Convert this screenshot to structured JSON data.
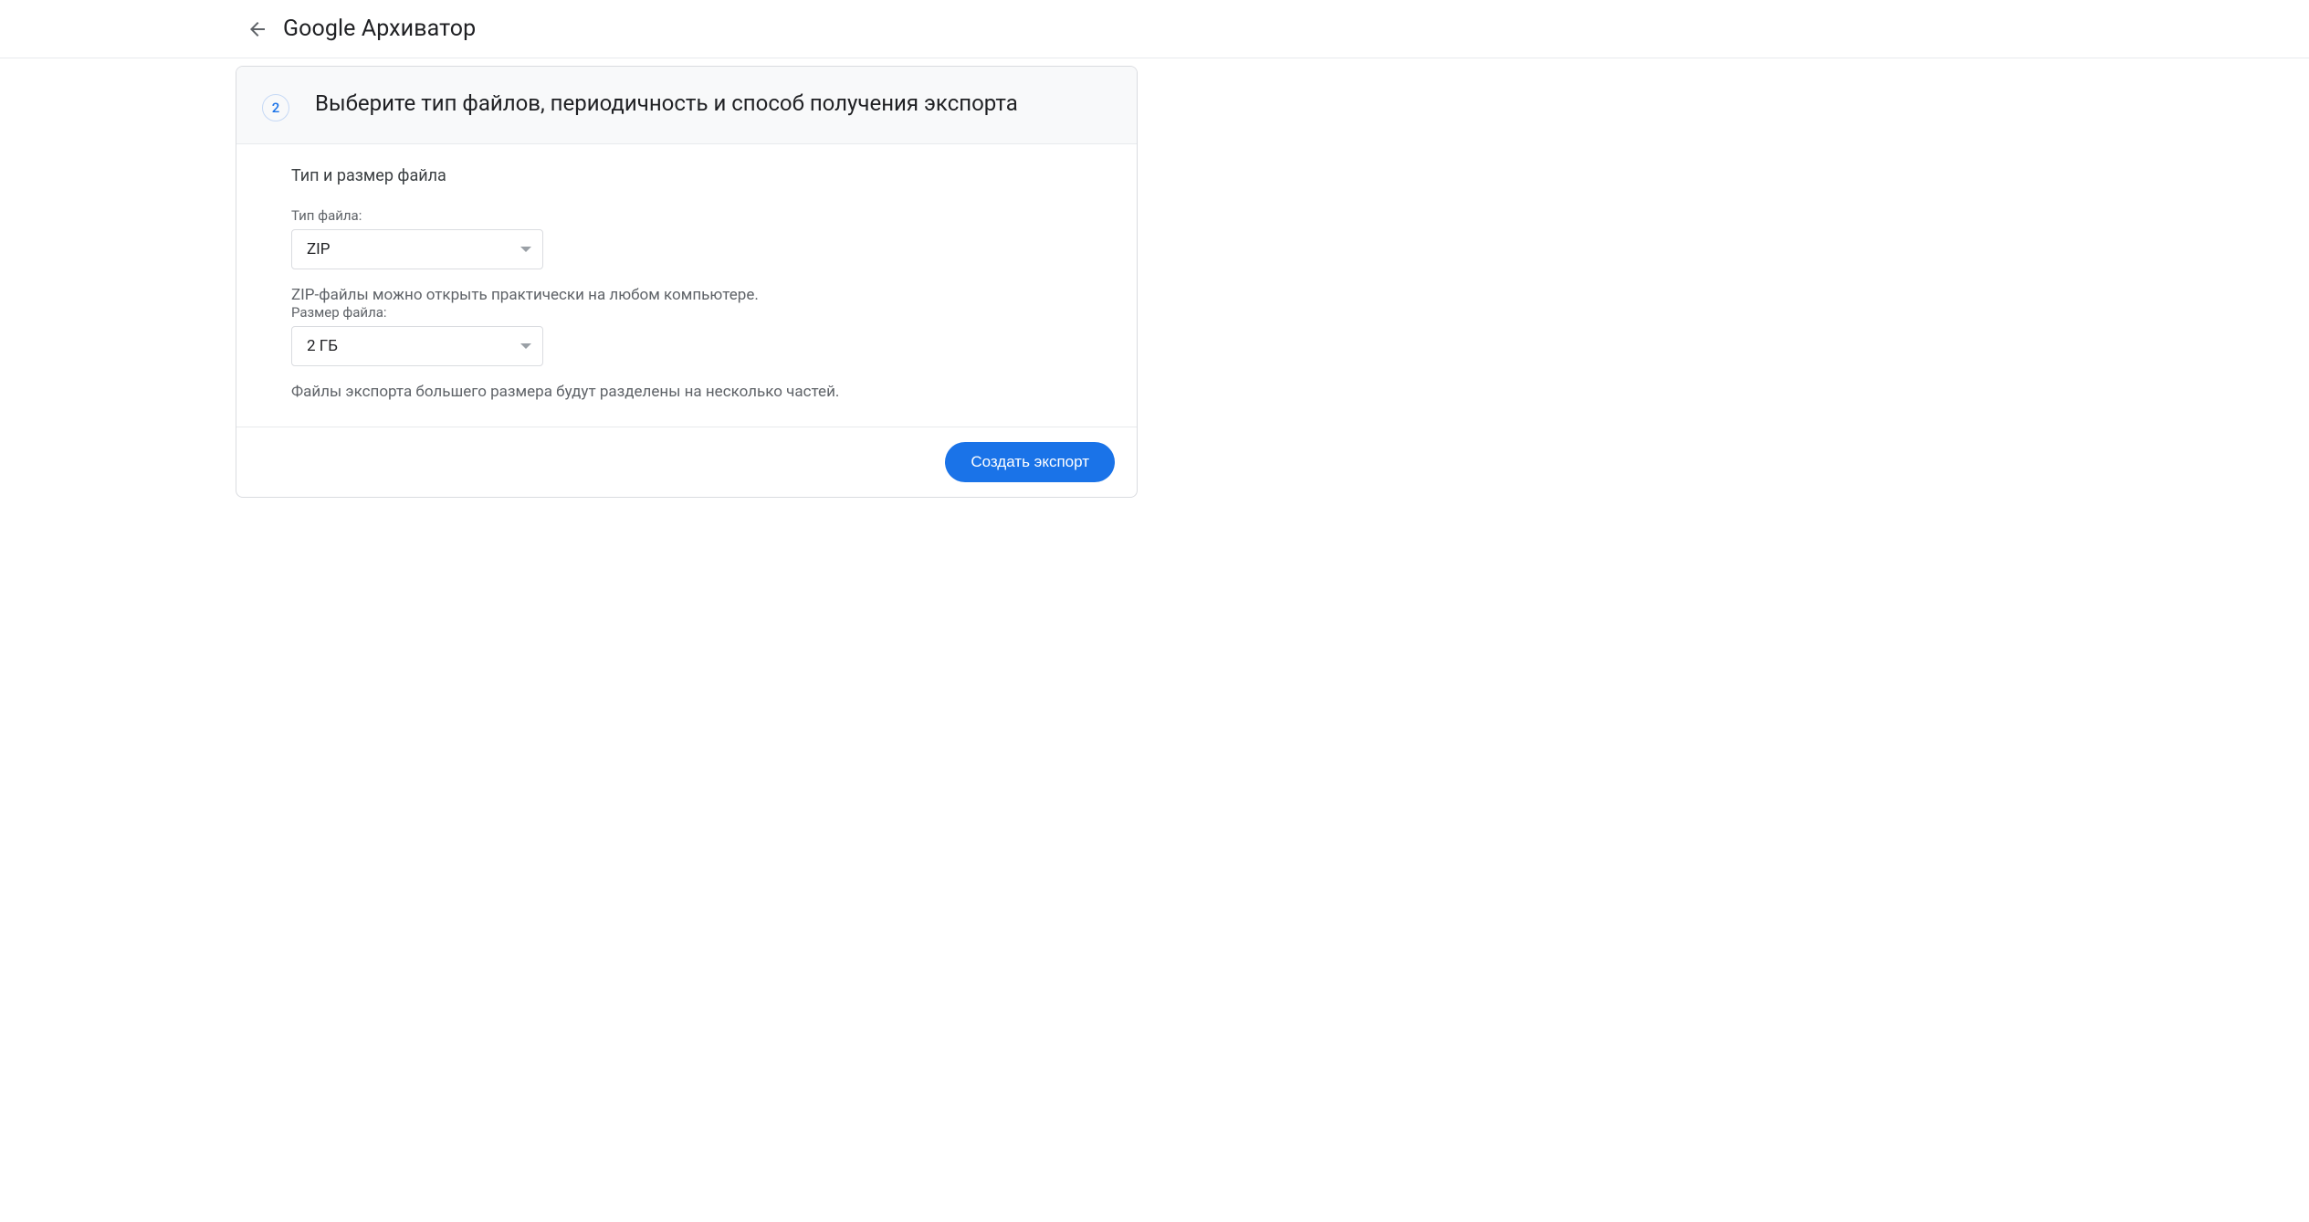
{
  "header": {
    "title": "Google Архиватор"
  },
  "step": {
    "number": "2",
    "title": "Выберите тип файлов, периодичность и способ получения экспорта"
  },
  "section_title": "Тип и размер файла",
  "file_type": {
    "label": "Тип файла:",
    "value": "ZIP",
    "helper": "ZIP-файлы можно открыть практически на любом компьютере."
  },
  "file_size": {
    "label": "Размер файла:",
    "value": "2 ГБ",
    "helper": "Файлы экспорта большего размера будут разделены на несколько частей."
  },
  "create_export_label": "Создать экспорт"
}
